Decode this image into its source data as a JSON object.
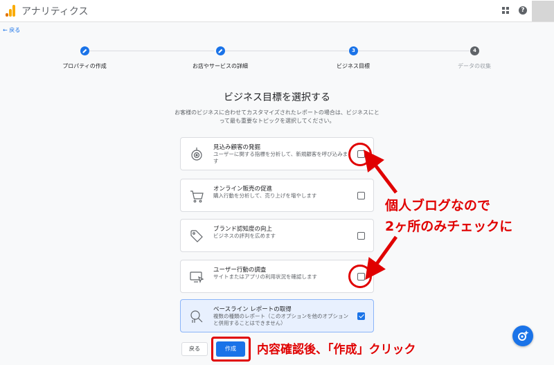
{
  "header": {
    "app_title": "アナリティクス",
    "help_glyph": "?"
  },
  "nav": {
    "back_label": "← 戻る"
  },
  "stepper": [
    {
      "label": "プロパティの作成",
      "state": "done"
    },
    {
      "label": "お店やサービスの詳細",
      "state": "done"
    },
    {
      "label": "ビジネス目標",
      "state": "current",
      "number": "3"
    },
    {
      "label": "データの収集",
      "state": "todo",
      "number": "4"
    }
  ],
  "main": {
    "title": "ビジネス目標を選択する",
    "description": "お客様のビジネスに合わせてカスタマイズされたレポートの場合は、ビジネスにとって最も重要なトピックを選択してください。"
  },
  "options": [
    {
      "title": "見込み顧客の発掘",
      "description": "ユーザーに関する指標を分析して、新規顧客を呼び込みます",
      "icon": "target-icon",
      "checked": false
    },
    {
      "title": "オンライン販売の促進",
      "description": "購入行動を分析して、売り上げを増やします",
      "icon": "cart-icon",
      "checked": false
    },
    {
      "title": "ブランド認知度の向上",
      "description": "ビジネスの評判を広めます",
      "icon": "tag-icon",
      "checked": false
    },
    {
      "title": "ユーザー行動の調査",
      "description": "サイトまたはアプリの利用状況を確認します",
      "icon": "screen-cursor-icon",
      "checked": false
    },
    {
      "title": "ベースライン レポートの取得",
      "description": "複数の種類のレポート（このオプションを他のオプションと併用することはできません）",
      "icon": "magnifier-icon",
      "checked": true
    }
  ],
  "footer": {
    "back_label": "戻る",
    "create_label": "作成"
  },
  "annotations": {
    "right_line1": "個人ブログなので",
    "right_line2": "2ヶ所のみチェックに",
    "bottom": "内容確認後、「作成」クリック"
  },
  "colors": {
    "primary": "#1a73e8",
    "annotation_red": "#e00000",
    "selected_card_bg": "#e8f0fe"
  }
}
